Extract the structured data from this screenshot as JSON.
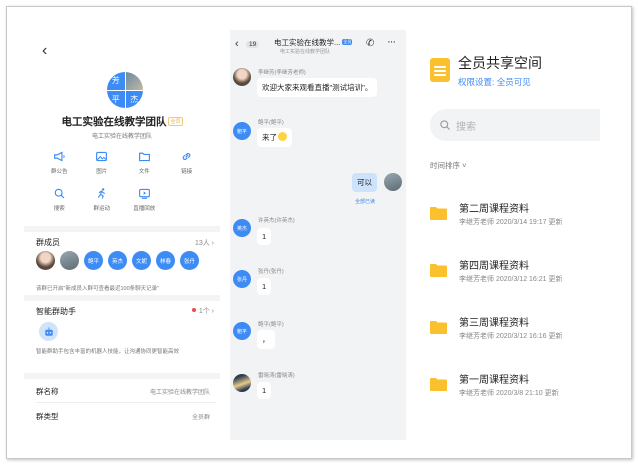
{
  "group_info": {
    "back_glyph": "‹",
    "avatar_cells": [
      "芳",
      "",
      "平",
      "杰"
    ],
    "group_name": "电工实验在线教学团队",
    "group_tag": "全员",
    "group_subtitle": "电工实验在线教学团队",
    "actions": [
      {
        "label": "群公告",
        "icon": "megaphone-icon"
      },
      {
        "label": "图片",
        "icon": "image-icon"
      },
      {
        "label": "文件",
        "icon": "folder-icon"
      },
      {
        "label": "链接",
        "icon": "link-icon"
      },
      {
        "label": "搜索",
        "icon": "search-icon"
      },
      {
        "label": "群运动",
        "icon": "run-icon"
      },
      {
        "label": "直播回放",
        "icon": "video-icon"
      }
    ],
    "members_title": "群成员",
    "members_count": "13人 ›",
    "members": [
      "",
      "",
      "鲍平",
      "英杰",
      "文妮",
      "林春",
      "张丹"
    ],
    "members_notice": "该群已开启\"新成员入群可查看最近100条聊天记录\"",
    "assistant_title": "智能群助手",
    "assistant_count": "1个 ›",
    "assistant_desc": "智能群助手包含丰富的机器人技能，让沟通协同更智能高效",
    "group_name_label": "群名称",
    "group_name_value": "电工实验在线教学团队",
    "group_type_label": "群类型",
    "group_type_value": "全员群"
  },
  "chat": {
    "back_glyph": "‹",
    "unread_count": "19",
    "title": "电工实验在线教学...",
    "title_badge": "全员",
    "subtitle": "电工实验在线教学团队",
    "messages": [
      {
        "sender": "李继芳(李继芳老师)",
        "avatar_text": "",
        "text": "欢迎大家来观看直播\"测试培训\"。"
      },
      {
        "sender": "鲍平(鲍平)",
        "avatar_text": "鲍平",
        "text": "来了"
      },
      {
        "sender": "",
        "avatar_text": "",
        "text": "可以",
        "mine": true,
        "status": "全部已读"
      },
      {
        "sender": "许英杰(许英杰)",
        "avatar_text": "英杰",
        "text": "1"
      },
      {
        "sender": "张丹(张丹)",
        "avatar_text": "张丹",
        "text": "1"
      },
      {
        "sender": "鲍平(鲍平)",
        "avatar_text": "鲍平",
        "text": "，"
      },
      {
        "sender": "雷晓涛(雷晓涛)",
        "avatar_text": "",
        "text": "1"
      }
    ]
  },
  "space": {
    "title": "全员共享空间",
    "permission": "权限设置: 全员可见",
    "search_placeholder": "搜索",
    "sort_label": "时间排序 ˅",
    "files": [
      {
        "name": "第二周课程资料",
        "meta": "李继芳老师 2020/3/14 19:17 更新"
      },
      {
        "name": "第四周课程资料",
        "meta": "李继芳老师 2020/3/12 16:21 更新"
      },
      {
        "name": "第三周课程资料",
        "meta": "李继芳老师 2020/3/12 16:16 更新"
      },
      {
        "name": "第一周课程资料",
        "meta": "李继芳老师 2020/3/8 21:10 更新"
      }
    ]
  },
  "colors": {
    "accent": "#3d8bf5",
    "folder": "#fbc02d",
    "chat_bg": "#f2f3f5",
    "my_bubble": "#cde2fb"
  }
}
